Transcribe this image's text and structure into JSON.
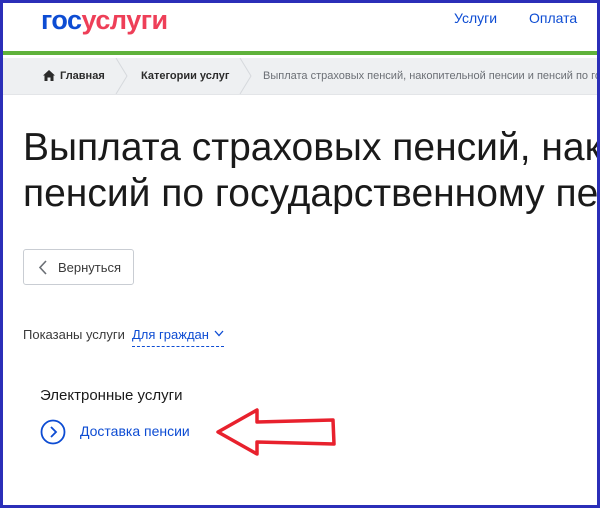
{
  "header": {
    "logo_part1": "гос",
    "logo_part2": "услуги",
    "nav": [
      {
        "label": "Услуги"
      },
      {
        "label": "Оплата"
      }
    ]
  },
  "breadcrumb": {
    "home": "Главная",
    "categories": "Категории услуг",
    "current": "Выплата страховых пенсий, накопительной пенсии и пенсий по госуда"
  },
  "page": {
    "title_line1": "Выплата страховых пенсий, накопительной пенсии и",
    "title_line2": "пенсий по государственному пенсионному обеспечению"
  },
  "back_button": {
    "label": "Вернуться"
  },
  "filter": {
    "label": "Показаны услуги",
    "value": "Для граждан"
  },
  "services": {
    "section_title": "Электронные услуги",
    "items": [
      {
        "label": "Доставка пенсии"
      }
    ]
  },
  "colors": {
    "brand_blue": "#0d4cd3",
    "brand_red": "#ee3f58",
    "header_line": "#5fb23b",
    "annotation_arrow": "#e8212d",
    "frame": "#2b2fb8"
  },
  "icons": {
    "home": "home-icon",
    "back": "chevron-left-icon",
    "dropdown": "chevron-down-icon",
    "service": "circle-chevron-right-icon",
    "annotation": "arrow-left-annotation"
  }
}
